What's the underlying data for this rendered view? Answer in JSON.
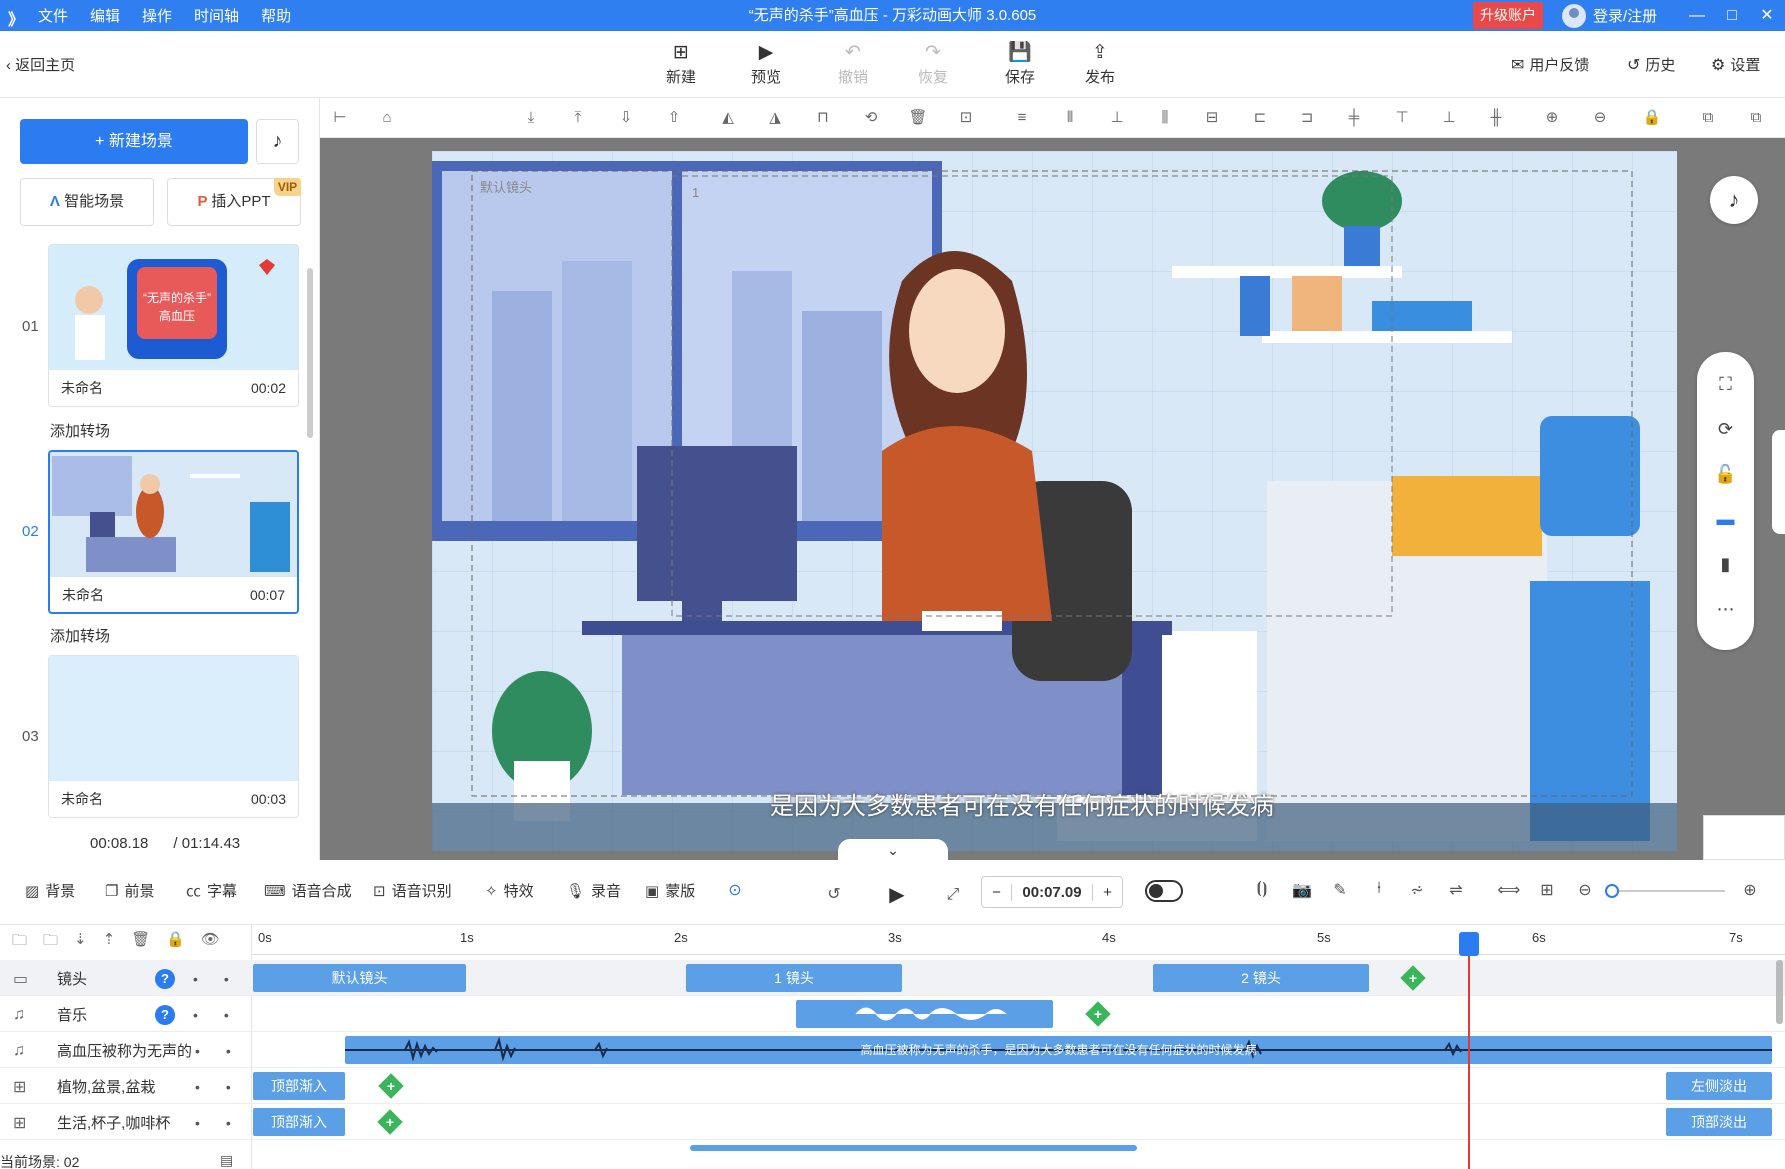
{
  "titlebar": {
    "logo": "》",
    "menu": [
      "文件",
      "编辑",
      "操作",
      "时间轴",
      "帮助"
    ],
    "title": "“无声的杀手”高血压 - 万彩动画大师 3.0.605",
    "upgrade": "升级账户",
    "login": "登录/注册",
    "min": "—",
    "max": "□",
    "close": "✕"
  },
  "toolbar": {
    "back": "返回主页",
    "buttons": [
      {
        "label": "新建",
        "icon": "⊞"
      },
      {
        "label": "预览",
        "icon": "▶"
      },
      {
        "label": "撤销",
        "icon": "↶"
      },
      {
        "label": "恢复",
        "icon": "↷"
      },
      {
        "label": "保存",
        "icon": "💾"
      },
      {
        "label": "发布",
        "icon": "⇪"
      }
    ],
    "feedback": "用户反馈",
    "history": "历史",
    "settings": "设置"
  },
  "left": {
    "new_scene": "+ 新建场景",
    "smart_scene": "智能场景",
    "insert_ppt": "插入PPT",
    "vip": "VIP",
    "scenes": [
      {
        "num": "01",
        "name": "未命名",
        "time": "00:02",
        "thumb_text": "“无声的杀手” 高血压"
      },
      {
        "num": "02",
        "name": "未命名",
        "time": "00:07"
      },
      {
        "num": "03",
        "name": "未命名",
        "time": "00:03"
      }
    ],
    "add_transition": "添加转场",
    "time_current": "00:08.18",
    "time_total": "/ 01:14.43"
  },
  "canvas": {
    "subtitle": "是因为大多数患者可在没有任何症状的时候发病",
    "camera_default": "默认镜头",
    "camera_1": "1"
  },
  "tlcontrols": {
    "items": [
      "背景",
      "前景",
      "字幕",
      "语音合成",
      "语音识别",
      "特效",
      "录音",
      "蒙版"
    ],
    "time": "00:07.09",
    "minus": "−",
    "plus": "+"
  },
  "ruler": [
    "0s",
    "1s",
    "2s",
    "3s",
    "4s",
    "5s",
    "6s",
    "7s"
  ],
  "tracks": [
    {
      "name": "镜头",
      "icon": "▭"
    },
    {
      "name": "音乐",
      "icon": "♫"
    },
    {
      "name": "高血压被称为无声的",
      "icon": "♫"
    },
    {
      "name": "植物,盆景,盆栽",
      "icon": "⊞"
    },
    {
      "name": "生活,杯子,咖啡杯",
      "icon": "⊞"
    }
  ],
  "clips": {
    "cam_default": "默认镜头",
    "cam_1": "1 镜头",
    "cam_2": "2 镜头",
    "voice_text": "高血压被称为无声的杀手，是因为大多数患者可在没有任何症状的时候发病",
    "enter_top": "顶部渐入",
    "exit_left": "左侧淡出",
    "exit_top": "顶部淡出"
  },
  "status": "当前场景: 02",
  "colors": {
    "accent": "#2a7cf0",
    "titlebar": "#2f7ff0",
    "upgrade": "#e94a49",
    "clip": "#5b9fe6",
    "playhead": "#e53935"
  }
}
